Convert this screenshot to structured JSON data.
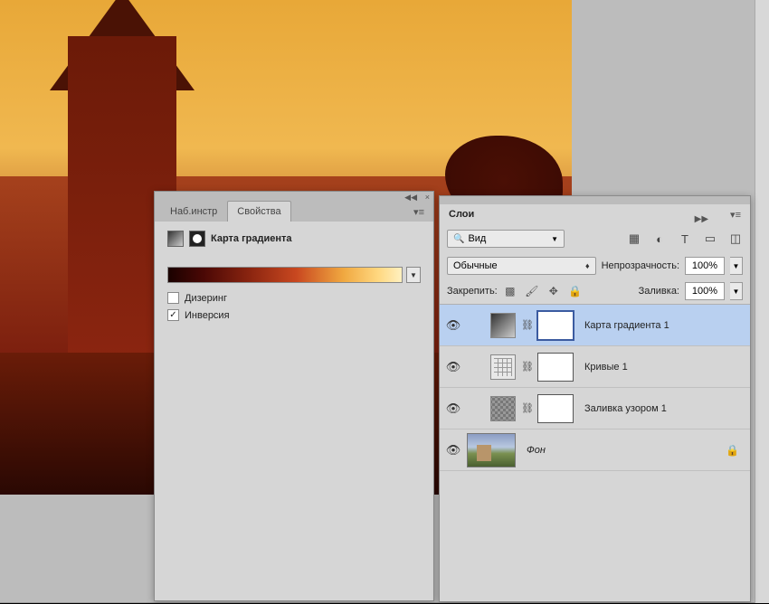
{
  "properties_panel": {
    "tabs": {
      "presets": "Наб.инстр",
      "properties": "Свойства"
    },
    "title": "Карта градиента",
    "dithering_label": "Дизеринг",
    "dithering_checked": false,
    "invert_label": "Инверсия",
    "invert_checked": true
  },
  "layers_panel": {
    "title": "Слои",
    "kind_label": "Вид",
    "blend_mode": "Обычные",
    "opacity_label": "Непрозрачность:",
    "opacity_value": "100%",
    "lock_label": "Закрепить:",
    "fill_label": "Заливка:",
    "fill_value": "100%",
    "layers": [
      {
        "name": "Карта градиента 1"
      },
      {
        "name": "Кривые 1"
      },
      {
        "name": "Заливка узором 1"
      },
      {
        "name": "Фон"
      }
    ]
  }
}
